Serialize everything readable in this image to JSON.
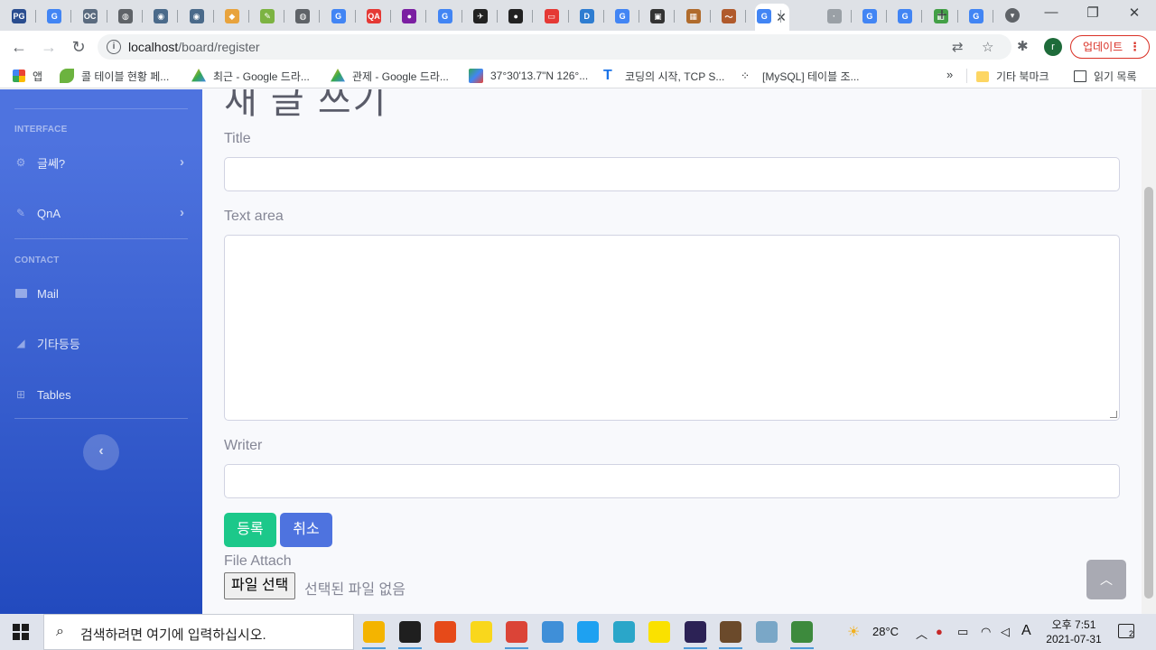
{
  "browser": {
    "url_host": "localhost",
    "url_path": "/board/register",
    "update_label": "업데이트",
    "profile_initial": "r",
    "bookmarks": [
      {
        "label": "앱",
        "icon": "apps-grid-icon",
        "color": "#4285f4"
      },
      {
        "label": "콜 테이블 현황 페...",
        "icon": "leaf-icon",
        "color": "#6cb33f"
      },
      {
        "label": "최근 - Google 드라...",
        "icon": "google-drive-icon",
        "color": "#fbbc04"
      },
      {
        "label": "관제 - Google 드라...",
        "icon": "google-drive-icon",
        "color": "#34a853"
      },
      {
        "label": "37°30'13.7\"N 126°...",
        "icon": "google-maps-icon",
        "color": "#ea4335"
      },
      {
        "label": "코딩의 시작, TCP S...",
        "icon": "tcp-school-icon",
        "color": "#1a73e8"
      },
      {
        "label": "[MySQL] 테이블 조...",
        "icon": "velog-icon",
        "color": "#202124"
      }
    ],
    "other_bookmarks": "기타 북마크",
    "reading_list": "읽기 목록"
  },
  "tabs": [
    {
      "icon": "pg-icon",
      "text": "PG",
      "color": "#2a4d8f"
    },
    {
      "icon": "google-icon",
      "text": "G",
      "color": "#4285f4"
    },
    {
      "icon": "ocad-icon",
      "text": "OC",
      "color": "#5b6b7f"
    },
    {
      "icon": "globe-icon",
      "text": "◍",
      "color": "#5f6368"
    },
    {
      "icon": "bot-icon",
      "text": "◉",
      "color": "#4a6a8a"
    },
    {
      "icon": "bot-icon",
      "text": "◉",
      "color": "#4a6a8a"
    },
    {
      "icon": "cube-icon",
      "text": "◆",
      "color": "#e8a33d"
    },
    {
      "icon": "pencil-icon",
      "text": "✎",
      "color": "#7cb342"
    },
    {
      "icon": "globe-icon",
      "text": "◍",
      "color": "#5f6368"
    },
    {
      "icon": "google-icon",
      "text": "G",
      "color": "#4285f4"
    },
    {
      "icon": "qa-icon",
      "text": "QA",
      "color": "#e53935"
    },
    {
      "icon": "circle-icon",
      "text": "●",
      "color": "#7b1fa2"
    },
    {
      "icon": "google-icon",
      "text": "G",
      "color": "#4285f4"
    },
    {
      "icon": "plane-icon",
      "text": "✈",
      "color": "#222222"
    },
    {
      "icon": "github-icon",
      "text": "●",
      "color": "#222222"
    },
    {
      "icon": "oracle-icon",
      "text": "▭",
      "color": "#e53935"
    },
    {
      "icon": "dell-icon",
      "text": "D",
      "color": "#2e7dd1"
    },
    {
      "icon": "google-icon",
      "text": "G",
      "color": "#4285f4"
    },
    {
      "icon": "robot-icon",
      "text": "▣",
      "color": "#333333"
    },
    {
      "icon": "image-icon",
      "text": "▦",
      "color": "#b06b2c"
    },
    {
      "icon": "brush-icon",
      "text": "〜",
      "color": "#b05a2c"
    },
    {
      "icon": "google-icon",
      "text": "G",
      "color": "#4285f4"
    },
    {
      "icon": "blank-icon",
      "text": "·",
      "color": "#9aa0a6"
    },
    {
      "icon": "google-icon",
      "text": "G",
      "color": "#4285f4"
    },
    {
      "icon": "google-icon",
      "text": "G",
      "color": "#4285f4"
    },
    {
      "icon": "colors-icon",
      "text": "▦",
      "color": "#43a047"
    },
    {
      "icon": "google-icon",
      "text": "G",
      "color": "#4285f4"
    }
  ],
  "sidebar": {
    "heading_interface": "INTERFACE",
    "heading_contact": "CONTACT",
    "items": [
      {
        "label": "글쎄?",
        "icon": "gear-icon",
        "glyph": "⚙"
      },
      {
        "label": "QnA",
        "icon": "wrench-icon",
        "glyph": "🔧"
      },
      {
        "label": "Mail",
        "icon": "folder-icon",
        "glyph": "▬"
      },
      {
        "label": "기타등등",
        "icon": "chart-area-icon",
        "glyph": "◢"
      },
      {
        "label": "Tables",
        "icon": "table-icon",
        "glyph": "⊞"
      }
    ],
    "toggle_glyph": "‹"
  },
  "form": {
    "page_title": "새 글 쓰기",
    "title_label": "Title",
    "title_value": "",
    "textarea_label": "Text area",
    "textarea_value": "",
    "writer_label": "Writer",
    "writer_value": "",
    "submit_label": "등록",
    "cancel_label": "취소",
    "file_label": "File Attach",
    "file_button": "파일 선택",
    "file_status": "선택된 파일 없음"
  },
  "taskbar": {
    "search_placeholder": "검색하려면 여기에 입력하십시오.",
    "weather": "28°C",
    "time": "오후 7:51",
    "date": "2021-07-31",
    "ime": "A",
    "notifications": "2",
    "apps": [
      {
        "icon": "file-explorer-icon",
        "color": "#f4b400"
      },
      {
        "icon": "terminal-icon",
        "color": "#1f1f1f"
      },
      {
        "icon": "intellij-icon",
        "color": "#e64a19"
      },
      {
        "icon": "sticky-notes-icon",
        "color": "#f9d71c"
      },
      {
        "icon": "chrome-icon",
        "color": "#db4437"
      },
      {
        "icon": "remote-desktop-icon",
        "color": "#3f8fd8"
      },
      {
        "icon": "internet-explorer-icon",
        "color": "#1ea1f1"
      },
      {
        "icon": "paint-icon",
        "color": "#2aa6c9"
      },
      {
        "icon": "kakaotalk-icon",
        "color": "#fae100"
      },
      {
        "icon": "eclipse-icon",
        "color": "#2c2255"
      },
      {
        "icon": "gear-app-icon",
        "color": "#6b4a2b"
      },
      {
        "icon": "database-icon",
        "color": "#7aa7c7"
      },
      {
        "icon": "media-icon",
        "color": "#3d8a3d"
      }
    ]
  }
}
